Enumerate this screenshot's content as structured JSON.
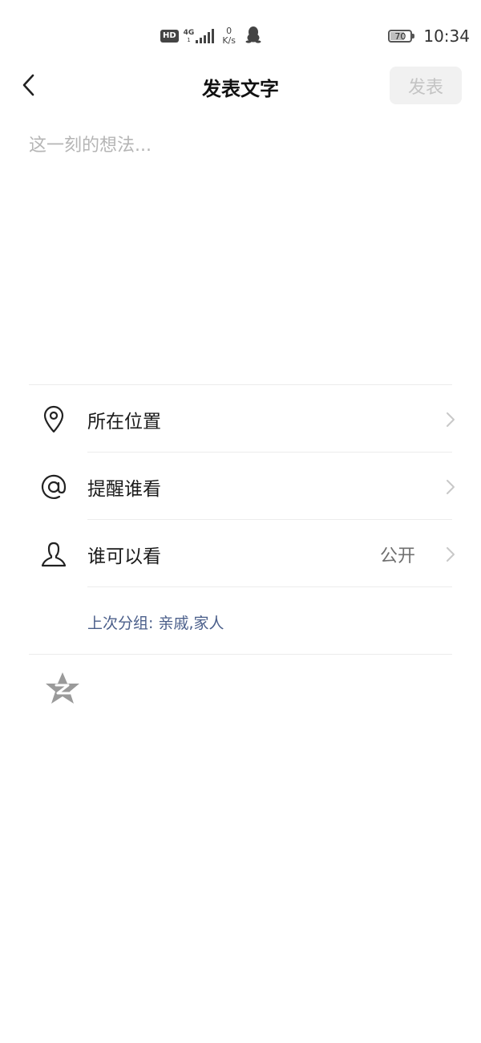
{
  "status_bar": {
    "hd_label": "HD",
    "network_label": "4G",
    "network_sub": "1",
    "speed_value": "0",
    "speed_unit": "K/s",
    "battery_level": 70,
    "battery_text": "70",
    "time": "10:34",
    "icons": [
      "hd-icon",
      "signal-icon",
      "qq-penguin-icon",
      "battery-icon"
    ]
  },
  "nav": {
    "back_icon": "chevron-left-icon",
    "title": "发表文字",
    "publish_label": "发表"
  },
  "editor": {
    "placeholder": "这一刻的想法...",
    "value": ""
  },
  "options": [
    {
      "label": "所在位置",
      "icon": "location-pin-icon",
      "value": ""
    },
    {
      "label": "提醒谁看",
      "icon": "at-sign-icon",
      "value": ""
    },
    {
      "label": "谁可以看",
      "icon": "person-icon",
      "value": "公开"
    }
  ],
  "last_group_text": "上次分组: 亲戚,家人",
  "footer": {
    "qzone_icon": "qzone-star-icon"
  },
  "colors": {
    "publish_disabled_bg": "#f1f1f1",
    "publish_disabled_text": "#c4c4c4",
    "link_blue": "#4a5e8a",
    "divider": "#ececec"
  }
}
